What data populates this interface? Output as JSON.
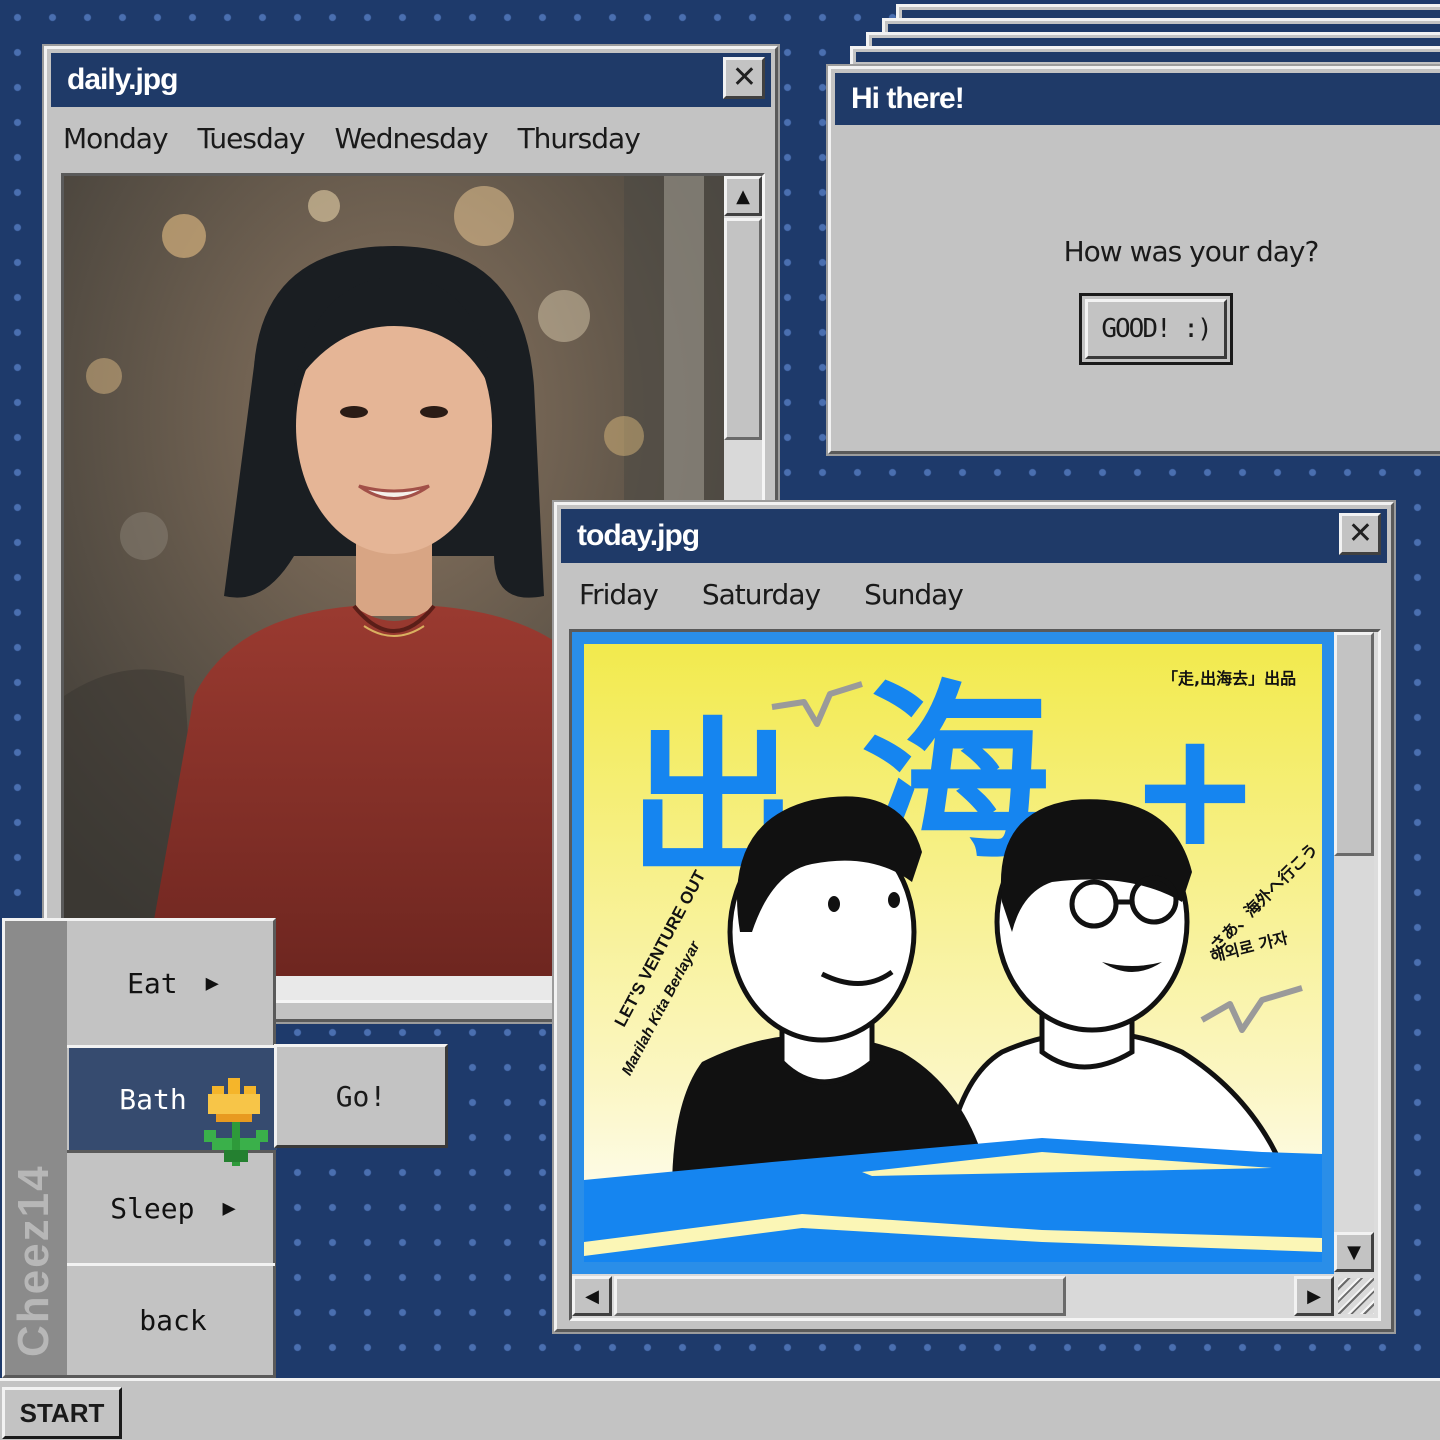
{
  "windows": {
    "daily": {
      "title": "daily.jpg",
      "menu": [
        "Monday",
        "Tuesday",
        "Wednesday",
        "Thursday"
      ],
      "close": "✕"
    },
    "dialog": {
      "title": "Hi there!",
      "message": "How was your day?",
      "button": "GOOD! :)"
    },
    "today": {
      "title": "today.jpg",
      "menu": [
        "Friday",
        "Saturday",
        "Sunday"
      ],
      "close": "✕"
    }
  },
  "poster": {
    "big_chars": [
      "出",
      "海",
      "+"
    ],
    "tag_top_right": "「走,出海去」出品",
    "left_line1": "LET'S VENTURE OUT",
    "left_line2": "Marilah Kita Berlayar",
    "right_line1": "さあ、海外へ行こう",
    "right_line2": "해외로 가자",
    "colors": {
      "yellow": "#f2ea4d",
      "blue": "#1585f0",
      "cream": "#fbf6b6",
      "frame": "#2a8ee8"
    }
  },
  "start_menu": {
    "sidebar_label": "Cheez14",
    "items": [
      {
        "label": "Eat",
        "arrow": "▶"
      },
      {
        "label": "Bath",
        "arrow": ""
      },
      {
        "label": "Sleep",
        "arrow": "▶"
      },
      {
        "label": "back",
        "arrow": ""
      }
    ],
    "submenu_button": "Go!",
    "highlight_color": "#364b6f"
  },
  "taskbar": {
    "start_label": "START"
  },
  "icons": {
    "cursor": "tulip-cursor-icon",
    "scroll_up": "▲",
    "scroll_down": "▼",
    "scroll_left": "◀",
    "scroll_right": "▶"
  }
}
